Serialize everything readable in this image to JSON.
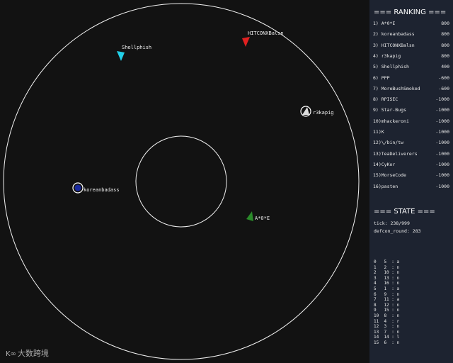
{
  "ranking": {
    "header": "=== RANKING ===",
    "rows": [
      {
        "label": "1) A*0*E",
        "score": "800"
      },
      {
        "label": "2) koreanbadass",
        "score": "800"
      },
      {
        "label": "3) HITCONXBalsn",
        "score": "800"
      },
      {
        "label": "4) r3kapig",
        "score": "800"
      },
      {
        "label": "5) Shellphish",
        "score": "400"
      },
      {
        "label": "6) PPP",
        "score": "-600"
      },
      {
        "label": "7) MoreBushSmoked",
        "score": "-600"
      },
      {
        "label": "8) RPISEC",
        "score": "-1000"
      },
      {
        "label": "9) Star-Bugs",
        "score": "-1000"
      },
      {
        "label": "10)mhackeroni",
        "score": "-1000"
      },
      {
        "label": "11)K",
        "score": "-1000"
      },
      {
        "label": "12)\\/bin/tw",
        "score": "-1000"
      },
      {
        "label": "13)TeaDeliverers",
        "score": "-1000"
      },
      {
        "label": "14)CyKor",
        "score": "-1000"
      },
      {
        "label": "15)MorseCode",
        "score": "-1000"
      },
      {
        "label": "16)pasten",
        "score": "-1000"
      }
    ]
  },
  "state": {
    "header": "=== STATE ===",
    "tick": "tick: 238/999",
    "round": "defcon_round: 283"
  },
  "matchup_table": [
    "0   5  : a",
    "1   2  : n",
    "2   10 : n",
    "3   13 : n",
    "4   16 : n",
    "5   1  : a",
    "6   9  : n",
    "7   11 : a",
    "8   12 : n",
    "9   15 : n",
    "10  8  : n",
    "11  4  : r",
    "12  3  : n",
    "13  7  : n",
    "14  14 : l",
    "15  6  : n"
  ],
  "ships": [
    {
      "name": "Shellphish",
      "color": "#22d0e8"
    },
    {
      "name": "HITCONXBalsn",
      "color": "#e02020"
    },
    {
      "name": "r3kapig",
      "color": "#eeeeee"
    },
    {
      "name": "koreanbadass",
      "color": "#1a2aa0"
    },
    {
      "name": "A*0*E",
      "color": "#2a8a2a"
    }
  ],
  "watermark": "大数跨境"
}
